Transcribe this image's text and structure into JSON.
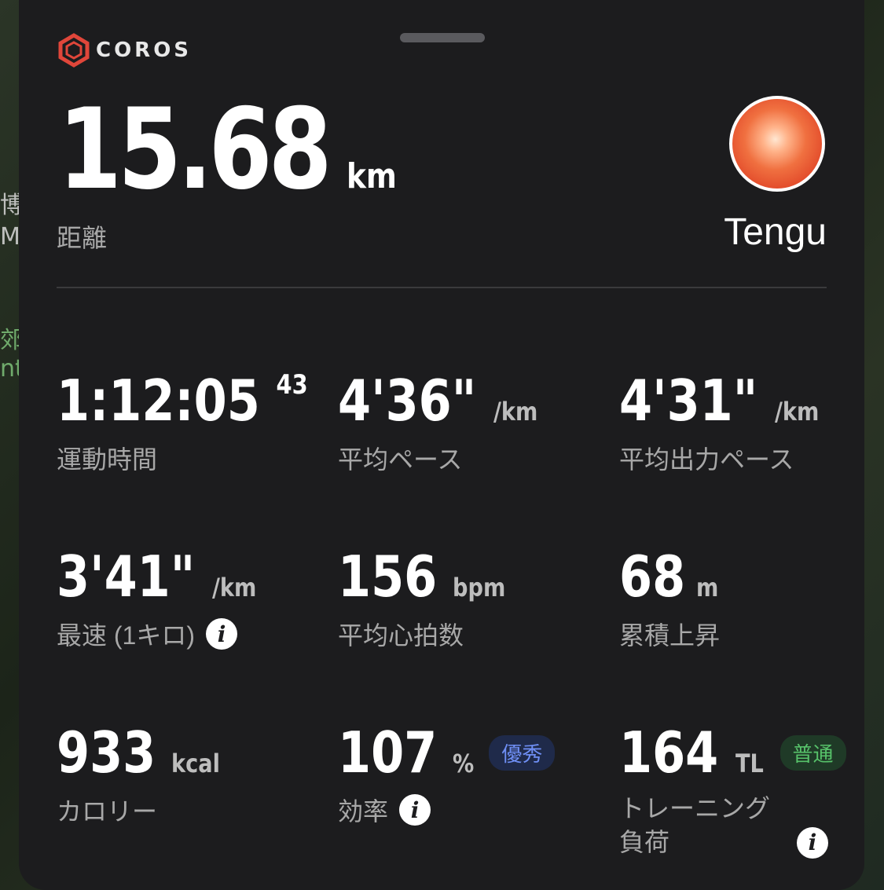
{
  "brand": {
    "name": "COROS"
  },
  "map_labels": [
    "博物",
    "Mu",
    "郊",
    "nt"
  ],
  "distance": {
    "value": "15.68",
    "unit": "km",
    "label": "距離"
  },
  "user": {
    "name": "Tengu"
  },
  "stats": {
    "time": {
      "value": "1:12:05",
      "sup": "43",
      "label": "運動時間"
    },
    "avg_pace": {
      "value": "4'36\"",
      "unit": "/km",
      "label": "平均ペース"
    },
    "avg_power_pace": {
      "value": "4'31\"",
      "unit": "/km",
      "label": "平均出力ペース"
    },
    "best_km": {
      "value": "3'41\"",
      "unit": "/km",
      "label": "最速 (1キロ)"
    },
    "avg_hr": {
      "value": "156",
      "unit": "bpm",
      "label": "平均心拍数"
    },
    "elev_gain": {
      "value": "68",
      "unit": "m",
      "label": "累積上昇"
    },
    "calories": {
      "value": "933",
      "unit": "kcal",
      "label": "カロリー"
    },
    "efficiency": {
      "value": "107",
      "unit": "%",
      "badge": "優秀",
      "label": "効率"
    },
    "training_load": {
      "value": "164",
      "unit": "TL",
      "badge": "普通",
      "label_line1": "トレーニング",
      "label_line2": "負荷"
    }
  },
  "colors": {
    "accent": "#e0463a",
    "badge_blue": "#6f8ff5",
    "badge_green": "#57c26a"
  }
}
